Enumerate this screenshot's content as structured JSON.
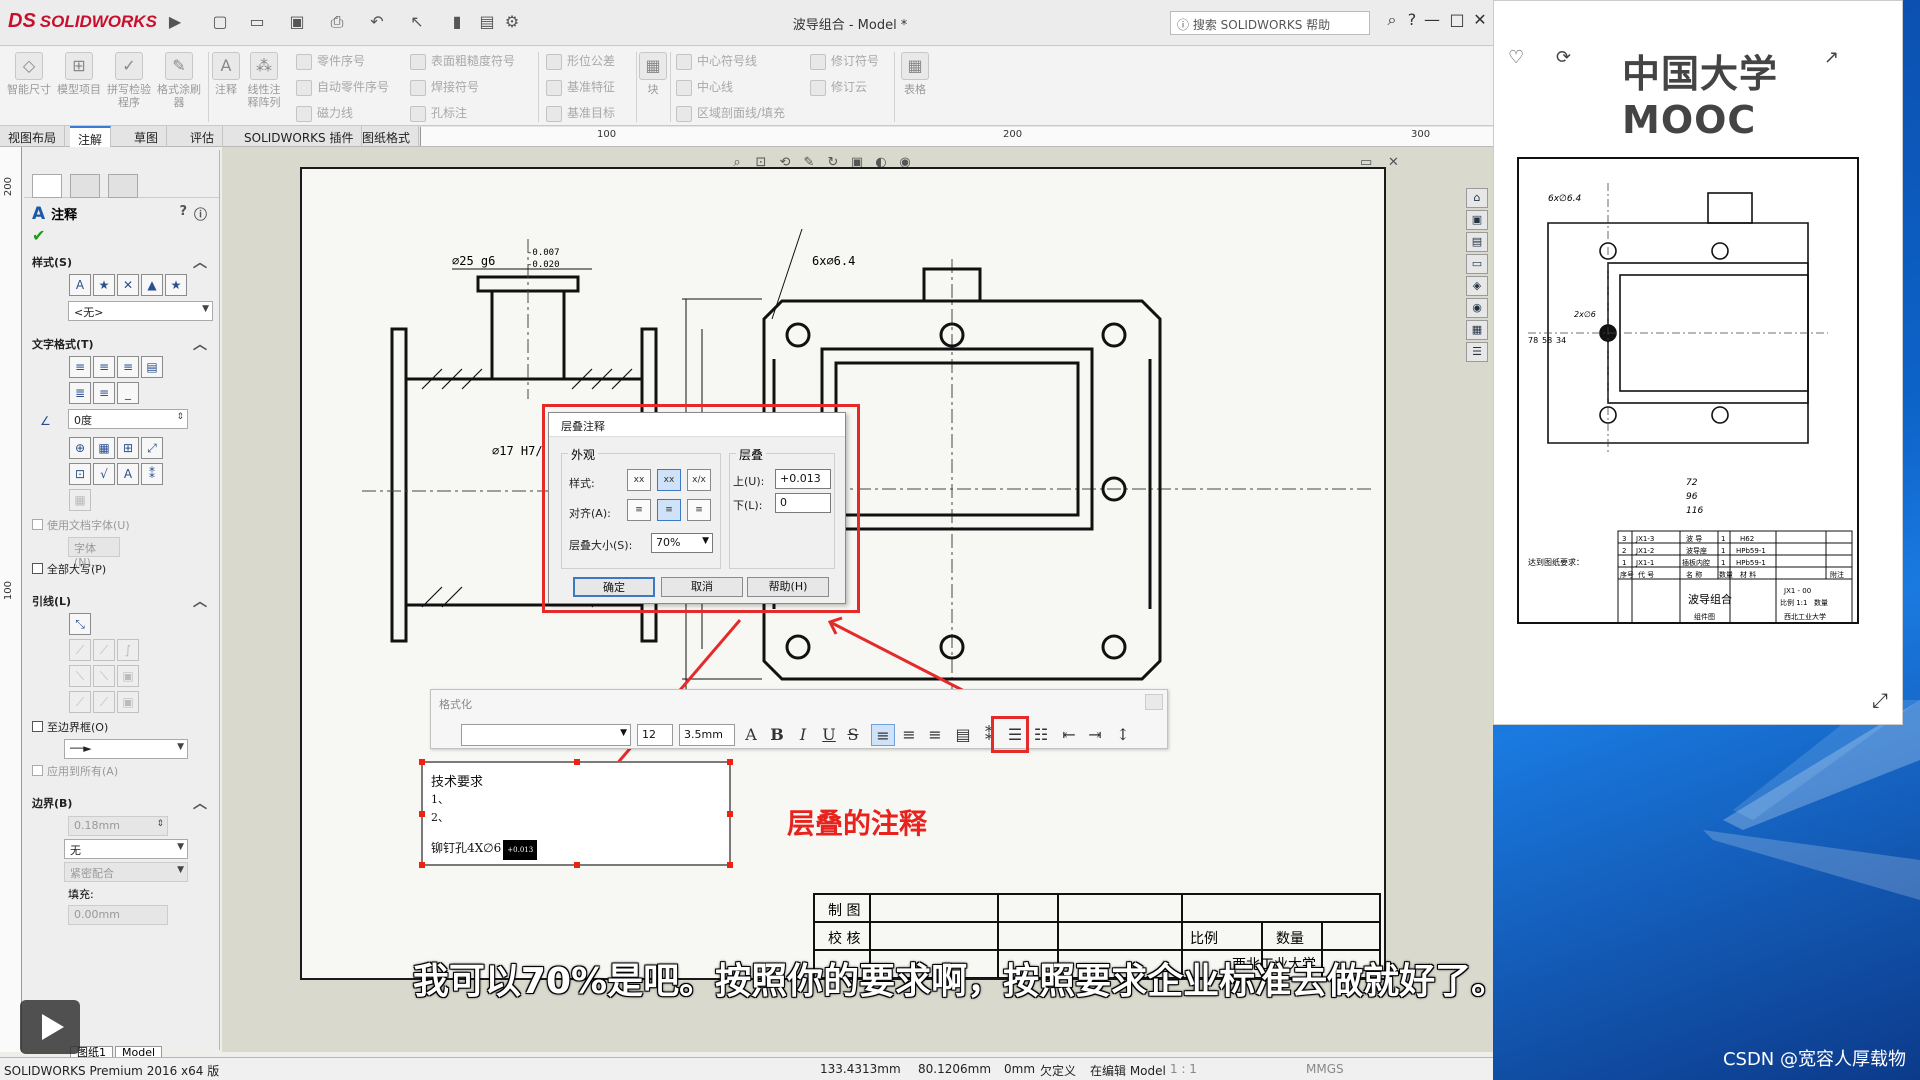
{
  "app": {
    "brand": "SOLIDWORKS",
    "window_title": "波导组合 - Model *",
    "search_placeholder": "搜索 SOLIDWORKS 帮助"
  },
  "ribbon": {
    "big": [
      {
        "label": "智能尺寸"
      },
      {
        "label": "模型项目"
      },
      {
        "label": "拼写检验程序"
      },
      {
        "label": "格式涂刷器"
      },
      {
        "label": "注释"
      },
      {
        "label": "线性注释阵列"
      }
    ],
    "small": [
      "零件序号",
      "自动零件序号",
      "磁力线",
      "表面粗糙度符号",
      "焊接符号",
      "孔标注",
      "形位公差",
      "基准特征",
      "基准目标",
      "块",
      "中心符号线",
      "中心线",
      "区域剖面线/填充",
      "修订符号",
      "修订云",
      "表格"
    ]
  },
  "tabs": [
    "视图布局",
    "注解",
    "草图",
    "评估",
    "SOLIDWORKS 插件",
    "图纸格式"
  ],
  "active_tab": "注解",
  "ruler_h": [
    "100",
    "200",
    "300"
  ],
  "ruler_v": [
    "200",
    "100"
  ],
  "pm": {
    "title": "注释",
    "groups": {
      "style": {
        "title": "样式(S)",
        "value": "<无>"
      },
      "text_format": {
        "title": "文字格式(T)",
        "angle": "0度",
        "use_doc_font": "使用文档字体(U)",
        "font_btn": "字体(N)...",
        "all_caps": "全部大写(P)"
      },
      "leader": {
        "title": "引线(L)",
        "to_border": "至边界框(O)",
        "apply_all": "应用到所有(A)"
      },
      "border": {
        "title": "边界(B)",
        "size": "0.18mm",
        "style": "无",
        "fit": "紧密配合",
        "fill_label": "填充:",
        "fill_value": "0.00mm"
      }
    }
  },
  "dialog": {
    "title": "层叠注释",
    "appearance_group": "外观",
    "style_label": "样式:",
    "align_label": "对齐(A):",
    "size_label": "层叠大小(S):",
    "size_value": "70%",
    "stack_group": "层叠",
    "upper_label": "上(U):",
    "upper_value": "+0.013",
    "lower_label": "下(L):",
    "lower_value": "0",
    "ok": "确定",
    "cancel": "取消",
    "help": "帮助(H)"
  },
  "format_bar": {
    "title": "格式化",
    "font_size": "12",
    "height": "3.5mm"
  },
  "note": {
    "line1": "技术要求",
    "line2": "1、",
    "line3": "2、",
    "line4": "铆钉孔4X∅6",
    "stack": "+0.013"
  },
  "drawing": {
    "dim1": "∅25 g6",
    "dim1_tol_upper": "-0.007",
    "dim1_tol_lower": "-0.020",
    "dim2": "6x∅6.4",
    "dim3": "∅17 H7/",
    "title_block": {
      "r1": "制 图",
      "r2": "校 核",
      "scale": "比例",
      "qty": "数量",
      "school": "西北工业大学"
    }
  },
  "annotation_caption": "层叠的注释",
  "subtitle": "我可以70%是吧。按照你的要求啊，按照要求企业标准去做就好了。",
  "status": {
    "product": "SOLIDWORKS Premium 2016 x64 版",
    "x": "133.4313mm",
    "y": "80.1206mm",
    "z": "0mm",
    "defined": "欠定义",
    "editing": "在编辑 Model",
    "scale": "1 : 1",
    "units": "MMGS"
  },
  "sheet_tabs": [
    "图纸1",
    "Model"
  ],
  "preview": {
    "logo": "中国大学MOOC",
    "dims": [
      "6x∅6.4",
      "2x∅6",
      "78",
      "58",
      "34",
      "72",
      "96",
      "116"
    ],
    "bom": [
      [
        "3",
        "JX1-3",
        "波 导",
        "1",
        "H62",
        ""
      ],
      [
        "2",
        "JX1-2",
        "波导座",
        "1",
        "HPb59-1",
        ""
      ],
      [
        "1",
        "JX1-1",
        "插板内腔",
        "1",
        "HPb59-1",
        ""
      ],
      [
        "序号",
        "代 号",
        "名 称",
        "数量",
        "材 料",
        "附注"
      ]
    ],
    "tb_title": "波导组合",
    "tb_code": "JX1 - 00",
    "tb_scale": "比例 1:1",
    "tb_qty": "数量",
    "tb_school": "西北工业大学",
    "tb_sub": "组件图",
    "tech_req": "达到图纸要求："
  },
  "watermark": "CSDN @宽容人厚载物",
  "colors": {
    "accent": "#e52a2a",
    "brand": "#c8102e",
    "selection": "#3b78c6"
  }
}
